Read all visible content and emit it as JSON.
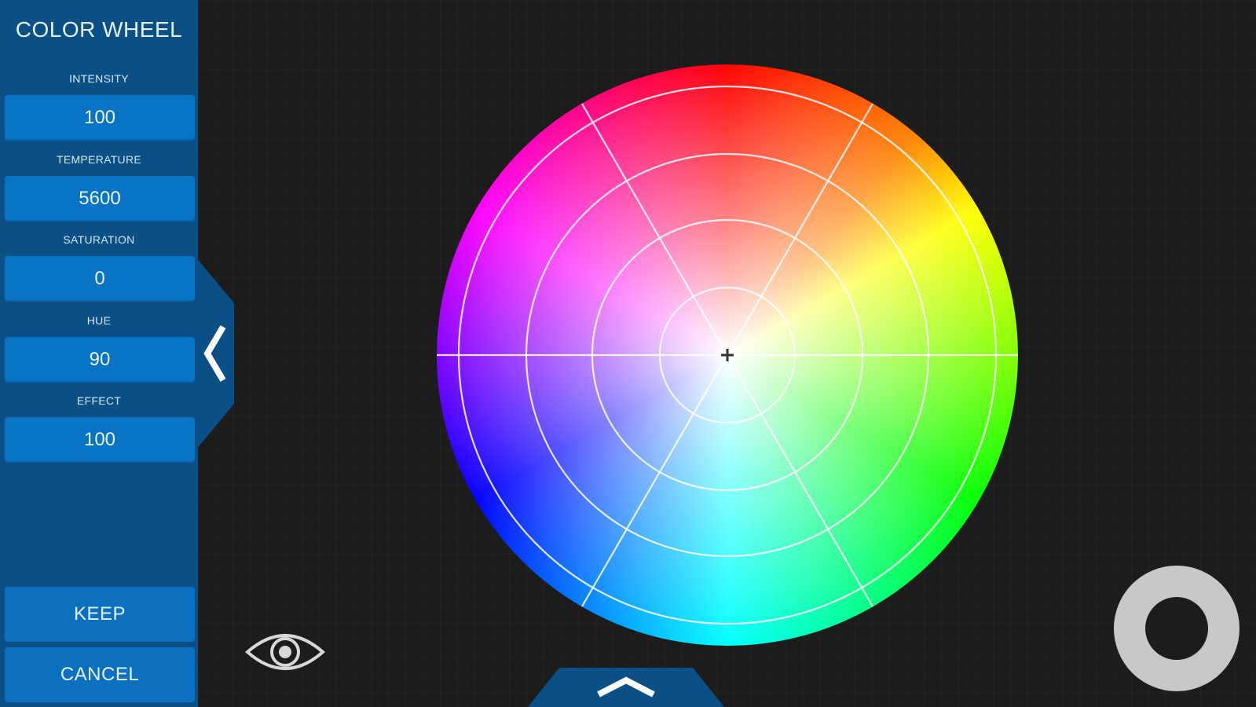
{
  "sidebar": {
    "title": "COLOR WHEEL",
    "fields": [
      {
        "label": "INTENSITY",
        "value": "100"
      },
      {
        "label": "TEMPERATURE",
        "value": "5600"
      },
      {
        "label": "SATURATION",
        "value": "0"
      },
      {
        "label": "HUE",
        "value": "90"
      },
      {
        "label": "EFFECT",
        "value": "100"
      }
    ],
    "keep_label": "KEEP",
    "cancel_label": "CANCEL"
  },
  "icons": {
    "collapse": "chevron-left-icon",
    "preview": "eye-icon",
    "expand": "chevron-up-icon",
    "record": "record-button-icon",
    "center": "crosshair-icon"
  },
  "colors": {
    "sidebar_bg": "#0a4f86",
    "field_bg": "#0a74c4",
    "canvas_bg": "#1c1c1c",
    "record_ring": "#c8c8c8",
    "record_core": "#1c1c1c"
  }
}
